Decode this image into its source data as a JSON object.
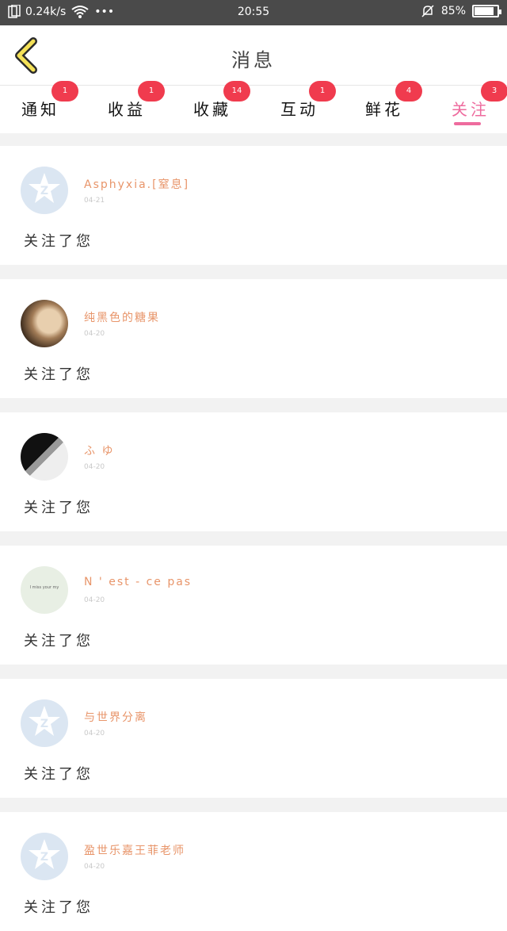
{
  "status_bar": {
    "speed": "0.24k/s",
    "dots": "•••",
    "time": "20:55",
    "battery_text": "85%",
    "battery_level": 0.85
  },
  "header": {
    "title": "消息",
    "back_icon": "chevron-left-icon"
  },
  "tabs": [
    {
      "label": "通知",
      "badge": "1",
      "active": false
    },
    {
      "label": "收益",
      "badge": "1",
      "active": false
    },
    {
      "label": "收藏",
      "badge": "14",
      "active": false
    },
    {
      "label": "互动",
      "badge": "1",
      "active": false
    },
    {
      "label": "鲜花",
      "badge": "4",
      "active": false
    },
    {
      "label": "关注",
      "badge": "3",
      "active": true
    }
  ],
  "colors": {
    "accent": "#ee6b9e",
    "badge": "#f03b4e",
    "name": "#e8956a"
  },
  "messages": [
    {
      "name": "Asphyxia.[窒息]",
      "date": "04-21",
      "text": "关注了您",
      "avatar": "default"
    },
    {
      "name": "纯黑色的糖果",
      "date": "04-20",
      "text": "关注了您",
      "avatar": "photo1"
    },
    {
      "name": "ふ ゆ",
      "date": "04-20",
      "text": "关注了您",
      "avatar": "photo2"
    },
    {
      "name": "N ' est - ce pas",
      "date": "04-20",
      "text": "关注了您",
      "avatar": "photo3",
      "avatar_text": "I miss your my"
    },
    {
      "name": "与世界分离",
      "date": "04-20",
      "text": "关注了您",
      "avatar": "default"
    },
    {
      "name": "盈世乐嘉王菲老师",
      "date": "04-20",
      "text": "关注了您",
      "avatar": "default"
    }
  ]
}
